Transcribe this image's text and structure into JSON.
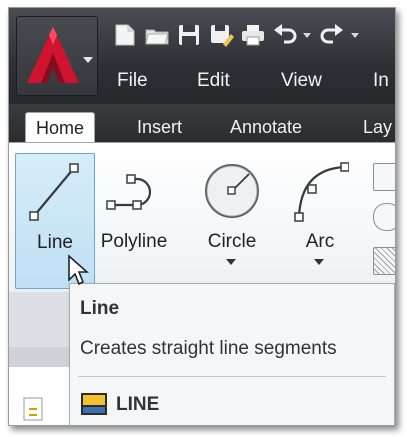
{
  "menu": {
    "items": [
      {
        "label": "File"
      },
      {
        "label": "Edit"
      },
      {
        "label": "View"
      },
      {
        "label": "In"
      }
    ]
  },
  "tabs": [
    {
      "label": "Home",
      "active": true
    },
    {
      "label": "Insert"
    },
    {
      "label": "Annotate"
    },
    {
      "label": "Lay"
    }
  ],
  "tools": [
    {
      "label": "Line",
      "icon": "line-icon",
      "selected": true
    },
    {
      "label": "Polyline",
      "icon": "polyline-icon"
    },
    {
      "label": "Circle",
      "icon": "circle-icon"
    },
    {
      "label": "Arc",
      "icon": "arc-icon"
    }
  ],
  "tooltip": {
    "title": "Line",
    "description": "Creates straight line segments",
    "command": "LINE"
  },
  "colors": {
    "accent_red": "#c8102e",
    "selected_bg": "#c9e6f7",
    "selected_border": "#6aa8cf",
    "titlebar": "#2e3036"
  }
}
